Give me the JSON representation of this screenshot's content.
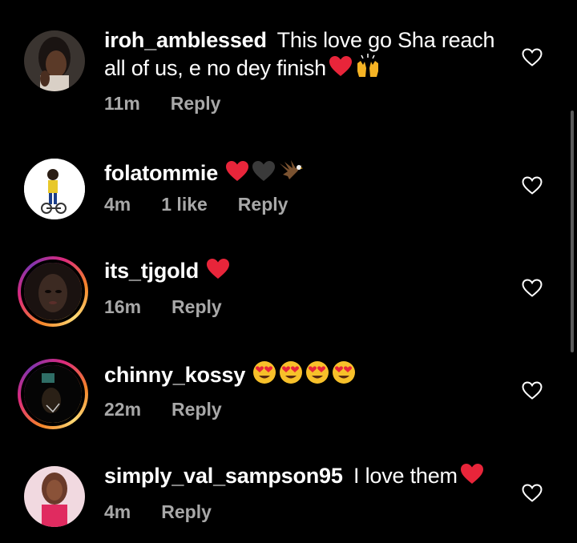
{
  "comments": [
    {
      "username": "iroh_amblessed",
      "text_line1": "This love go Sha reach",
      "text_line2": "all of us, e no dey finish",
      "emojis": [
        "red-heart",
        "raising-hands"
      ],
      "time": "11m",
      "likes": "",
      "reply": "Reply"
    },
    {
      "username": "folatommie",
      "text": "",
      "emojis": [
        "red-heart",
        "black-heart",
        "eagle"
      ],
      "time": "4m",
      "likes": "1 like",
      "reply": "Reply"
    },
    {
      "username": "its_tjgold",
      "text": "",
      "emojis": [
        "red-heart"
      ],
      "time": "16m",
      "likes": "",
      "reply": "Reply"
    },
    {
      "username": "chinny_kossy",
      "text": "",
      "emojis": [
        "heart-eyes",
        "heart-eyes",
        "heart-eyes",
        "heart-eyes"
      ],
      "time": "22m",
      "likes": "",
      "reply": "Reply"
    },
    {
      "username": "simply_val_sampson95",
      "text": "I love them",
      "emojis": [
        "red-heart"
      ],
      "time": "4m",
      "likes": "",
      "reply": "Reply"
    }
  ],
  "colors": {
    "background": "#000000",
    "text": "#ffffff",
    "meta": "#a8a8a8",
    "heart": "#e8253a",
    "story_ring": "#dd2a7b"
  },
  "icons": {
    "like": "heart-outline-icon"
  }
}
